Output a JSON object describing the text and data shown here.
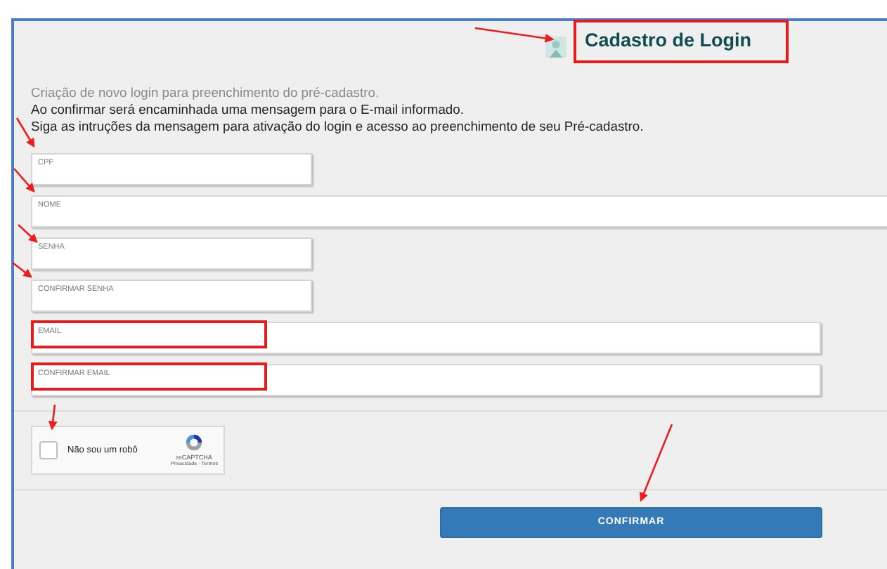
{
  "header": {
    "title": "Cadastro de Login",
    "highlighted": true
  },
  "intro": [
    {
      "text": "Criação de novo login para preenchimento do pré-cadastro.",
      "kind": "hint"
    },
    {
      "text": "Ao confirmar será encaminhada uma mensagem para o E-mail informado.",
      "kind": "info"
    },
    {
      "text": "Siga as intruções da mensagem para ativação do login e acesso ao preenchimento de seu Pré-cadastro.",
      "kind": "info"
    }
  ],
  "fields": [
    {
      "label": "CPF",
      "kind": "short",
      "highlighted": false
    },
    {
      "label": "NOME",
      "kind": "full",
      "highlighted": false
    },
    {
      "label": "SENHA",
      "kind": "short",
      "highlighted": false
    },
    {
      "label": "CONFIRMAR SENHA",
      "kind": "short",
      "highlighted": false
    },
    {
      "label": "EMAIL",
      "kind": "long",
      "highlighted": true
    },
    {
      "label": "CONFIRMAR EMAIL",
      "kind": "long",
      "highlighted": true
    }
  ],
  "captcha": {
    "label": "Não sou um robô",
    "checked": false,
    "brand": "reCAPTCHA",
    "links": "Privacidade - Termos"
  },
  "submit": {
    "label": "CONFIRMAR"
  }
}
